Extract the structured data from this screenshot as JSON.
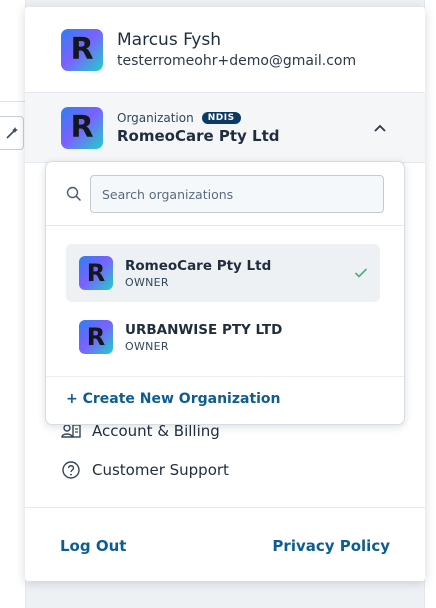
{
  "user": {
    "initial": "R",
    "name": "Marcus Fysh",
    "email": "testerromeohr+demo@gmail.com"
  },
  "organization": {
    "label": "Organization",
    "badge": "NDIS",
    "name": "RomeoCare Pty Ltd",
    "initial": "R",
    "expanded": true
  },
  "org_dropdown": {
    "search_placeholder": "Search organizations",
    "search_value": "",
    "options": [
      {
        "initial": "R",
        "name": "RomeoCare Pty Ltd",
        "role": "OWNER",
        "selected": true
      },
      {
        "initial": "R",
        "name": "URBANWISE PTY LTD",
        "role": "OWNER",
        "selected": false
      }
    ],
    "create_label": "+ Create New Organization"
  },
  "menu": {
    "account_billing": "Account & Billing",
    "customer_support": "Customer Support"
  },
  "footer": {
    "logout": "Log Out",
    "privacy": "Privacy Policy"
  },
  "colors": {
    "link": "#0e5d92",
    "badge_bg": "#0b3a66",
    "check": "#4caf7a",
    "selected_row_bg": "#eef1f4"
  }
}
